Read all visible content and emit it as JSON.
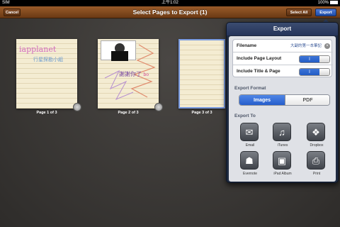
{
  "status_bar": {
    "carrier": "SIM",
    "time": "上午1:02",
    "battery": "100%"
  },
  "nav_bar": {
    "title": "Select Pages to Export (1)",
    "cancel_label": "Cancel",
    "select_all_label": "Select All",
    "export_label": "Export"
  },
  "pages": [
    {
      "caption": "Page 1 of 3",
      "handwriting_1": "iapplanet",
      "handwriting_2": "行星探勘小組"
    },
    {
      "caption": "Page 2 of 3",
      "handwriting_1": "謝謝你了",
      "handwriting_2": "bo"
    },
    {
      "caption": "Page 3 of 3"
    }
  ],
  "export_popover": {
    "title": "Export",
    "filename_label": "Filename",
    "filename_value": "大副的第一本筆記",
    "include_layout_label": "Include Page Layout",
    "include_title_label": "Include Title & Page",
    "toggle_on_text": "I",
    "format_label": "Export Format",
    "format_options": [
      "Images",
      "PDF"
    ],
    "format_selected": "Images",
    "export_to_label": "Export To",
    "targets": [
      {
        "label": "Email",
        "icon": "email-icon"
      },
      {
        "label": "iTunes",
        "icon": "itunes-icon"
      },
      {
        "label": "Dropbox",
        "icon": "dropbox-icon"
      },
      {
        "label": "Evernote",
        "icon": "evernote-icon"
      },
      {
        "label": "iPad Album",
        "icon": "ipad-album-icon"
      },
      {
        "label": "Print",
        "icon": "print-icon"
      }
    ]
  },
  "colors": {
    "nav_brown": "#7a4519",
    "popover_navy": "#1e2a40",
    "accent_blue": "#2f66d0"
  }
}
